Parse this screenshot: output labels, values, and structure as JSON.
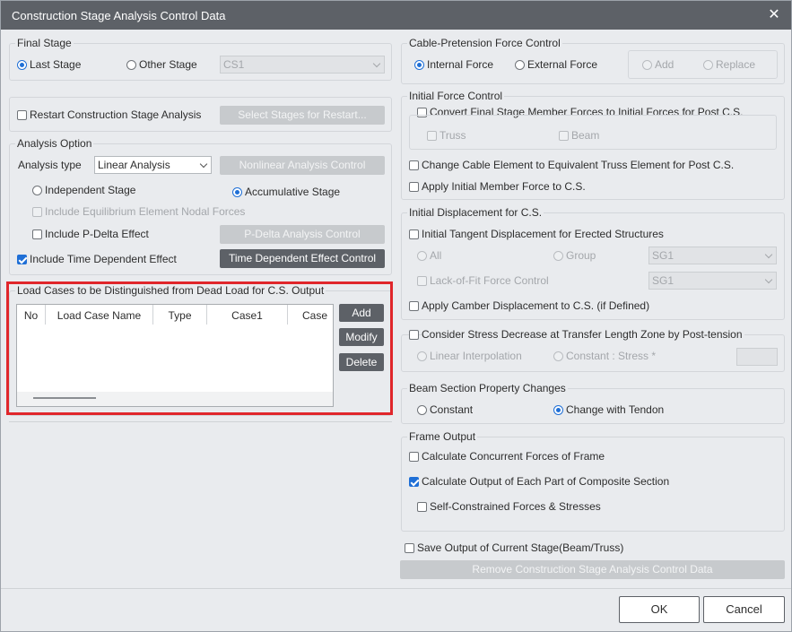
{
  "window": {
    "title": "Construction Stage Analysis Control Data",
    "close_glyph": "✕"
  },
  "final_stage": {
    "title": "Final Stage",
    "last_stage": "Last Stage",
    "other_stage": "Other Stage",
    "stage_value": "CS1"
  },
  "restart": {
    "label": "Restart Construction Stage Analysis",
    "button": "Select Stages for Restart..."
  },
  "analysis_option": {
    "title": "Analysis Option",
    "type_label": "Analysis type",
    "type_value": "Linear Analysis",
    "nonlinear_button": "Nonlinear Analysis Control",
    "independent": "Independent Stage",
    "accumulative": "Accumulative Stage",
    "equilibrium": "Include Equilibrium Element Nodal Forces",
    "pdelta": "Include P-Delta Effect",
    "pdelta_button": "P-Delta Analysis Control",
    "time_dep": "Include Time Dependent Effect",
    "time_dep_button": "Time Dependent Effect Control"
  },
  "load_cases": {
    "title": "Load Cases to be Distinguished from Dead Load for C.S. Output",
    "columns": [
      "No",
      "Load Case Name",
      "Type",
      "Case1",
      "Case"
    ],
    "add": "Add",
    "modify": "Modify",
    "delete": "Delete"
  },
  "cable": {
    "title": "Cable-Pretension Force Control",
    "internal": "Internal Force",
    "external": "External Force",
    "add": "Add",
    "replace": "Replace"
  },
  "initial_force": {
    "title": "Initial Force Control",
    "convert": "Convert Final Stage Member Forces to Initial Forces for Post C.S.",
    "truss": "Truss",
    "beam": "Beam",
    "change_cable": "Change Cable Element to Equivalent Truss Element for Post C.S.",
    "apply_initial": "Apply Initial Member Force to C.S."
  },
  "initial_disp": {
    "title": "Initial Displacement for C.S.",
    "tangent": "Initial Tangent Displacement for Erected Structures",
    "all": "All",
    "group": "Group",
    "group_value": "SG1",
    "lack_of_fit": "Lack-of-Fit Force Control",
    "lack_value": "SG1",
    "camber": "Apply Camber Displacement to C.S. (if Defined)"
  },
  "stress": {
    "label": "Consider Stress Decrease at Transfer Length Zone by Post-tension",
    "linear": "Linear Interpolation",
    "constant": "Constant : Stress *"
  },
  "beam_section": {
    "title": "Beam Section Property Changes",
    "constant": "Constant",
    "tendon": "Change with Tendon"
  },
  "frame_output": {
    "title": "Frame Output",
    "concurrent": "Calculate Concurrent Forces of Frame",
    "composite": "Calculate Output of Each Part of Composite Section",
    "self_constrained": "Self-Constrained Forces & Stresses"
  },
  "save_output": "Save Output of Current Stage(Beam/Truss)",
  "remove_button": "Remove Construction Stage Analysis Control Data",
  "ok": "OK",
  "cancel": "Cancel",
  "colors": {
    "title_bar": "#5d6167",
    "accent": "#1f6fd6",
    "highlight": "#e0262b",
    "background": "#e9ebee"
  }
}
